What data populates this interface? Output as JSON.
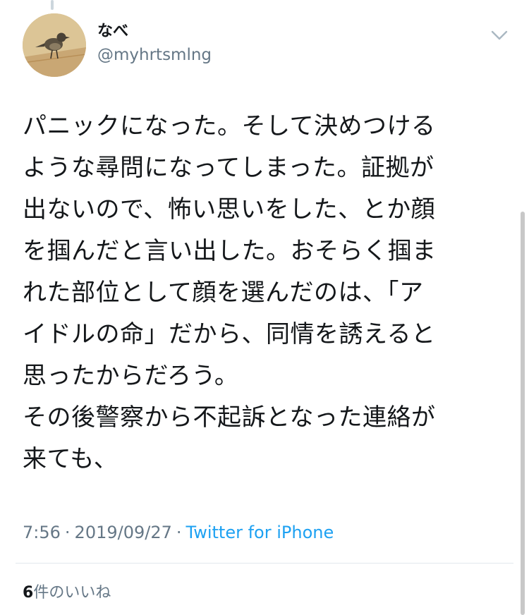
{
  "user": {
    "display_name": "なべ",
    "handle": "@myhrtsmlng"
  },
  "tweet": {
    "text": "パニックになった。そして決めつける\nような尋問になってしまった。証拠が\n出ないので、怖い思いをした、とか顔\nを掴んだと言い出した。おそらく掴ま\nれた部位として顔を選んだのは、「ア\nイドルの命」だから、同情を誘えると\n思ったからだろう。\nその後警察から不起訴となった連絡が\n来ても、",
    "time": "7:56",
    "date": "2019/09/27",
    "separator": "·",
    "source": "Twitter for iPhone"
  },
  "likes": {
    "count": "6",
    "label": "件のいいね"
  },
  "icons": {
    "avatar": "bird-photo-avatar",
    "menu": "chevron-down-icon"
  },
  "colors": {
    "text": "#14171a",
    "secondary": "#657786",
    "accent": "#1da1f2",
    "divider": "#e1e8ed"
  }
}
